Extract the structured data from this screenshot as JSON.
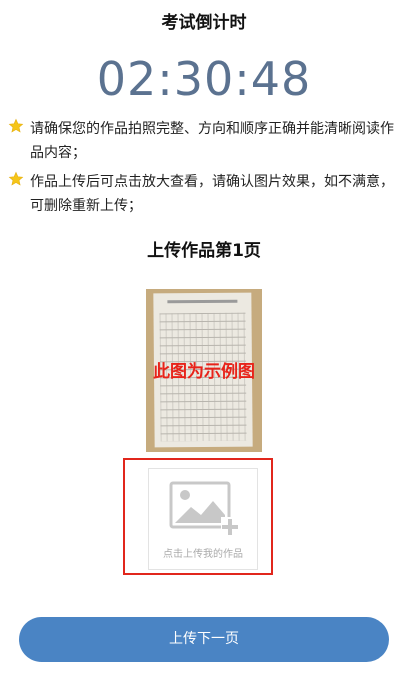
{
  "header": {
    "title": "考试倒计时",
    "countdown": "02:30:48"
  },
  "notices": [
    {
      "icon": "star-icon",
      "text": "请确保您的作品拍照完整、方向和顺序正确并能清晰阅读作品内容；"
    },
    {
      "icon": "star-icon",
      "text": "作品上传后可点击放大查看，请确认图片效果，如不满意，可删除重新上传；"
    }
  ],
  "section": {
    "title": "上传作品第1页"
  },
  "sample": {
    "watermark": "此图为示例图"
  },
  "upload": {
    "icon": "add-image-icon",
    "label": "点击上传我的作品"
  },
  "next_button": {
    "label": "上传下一页"
  },
  "colors": {
    "countdown": "#5b7290",
    "star": "#f5c518",
    "highlight": "#e1261c",
    "button": "#4a84c4",
    "watermark": "#e8231a"
  }
}
